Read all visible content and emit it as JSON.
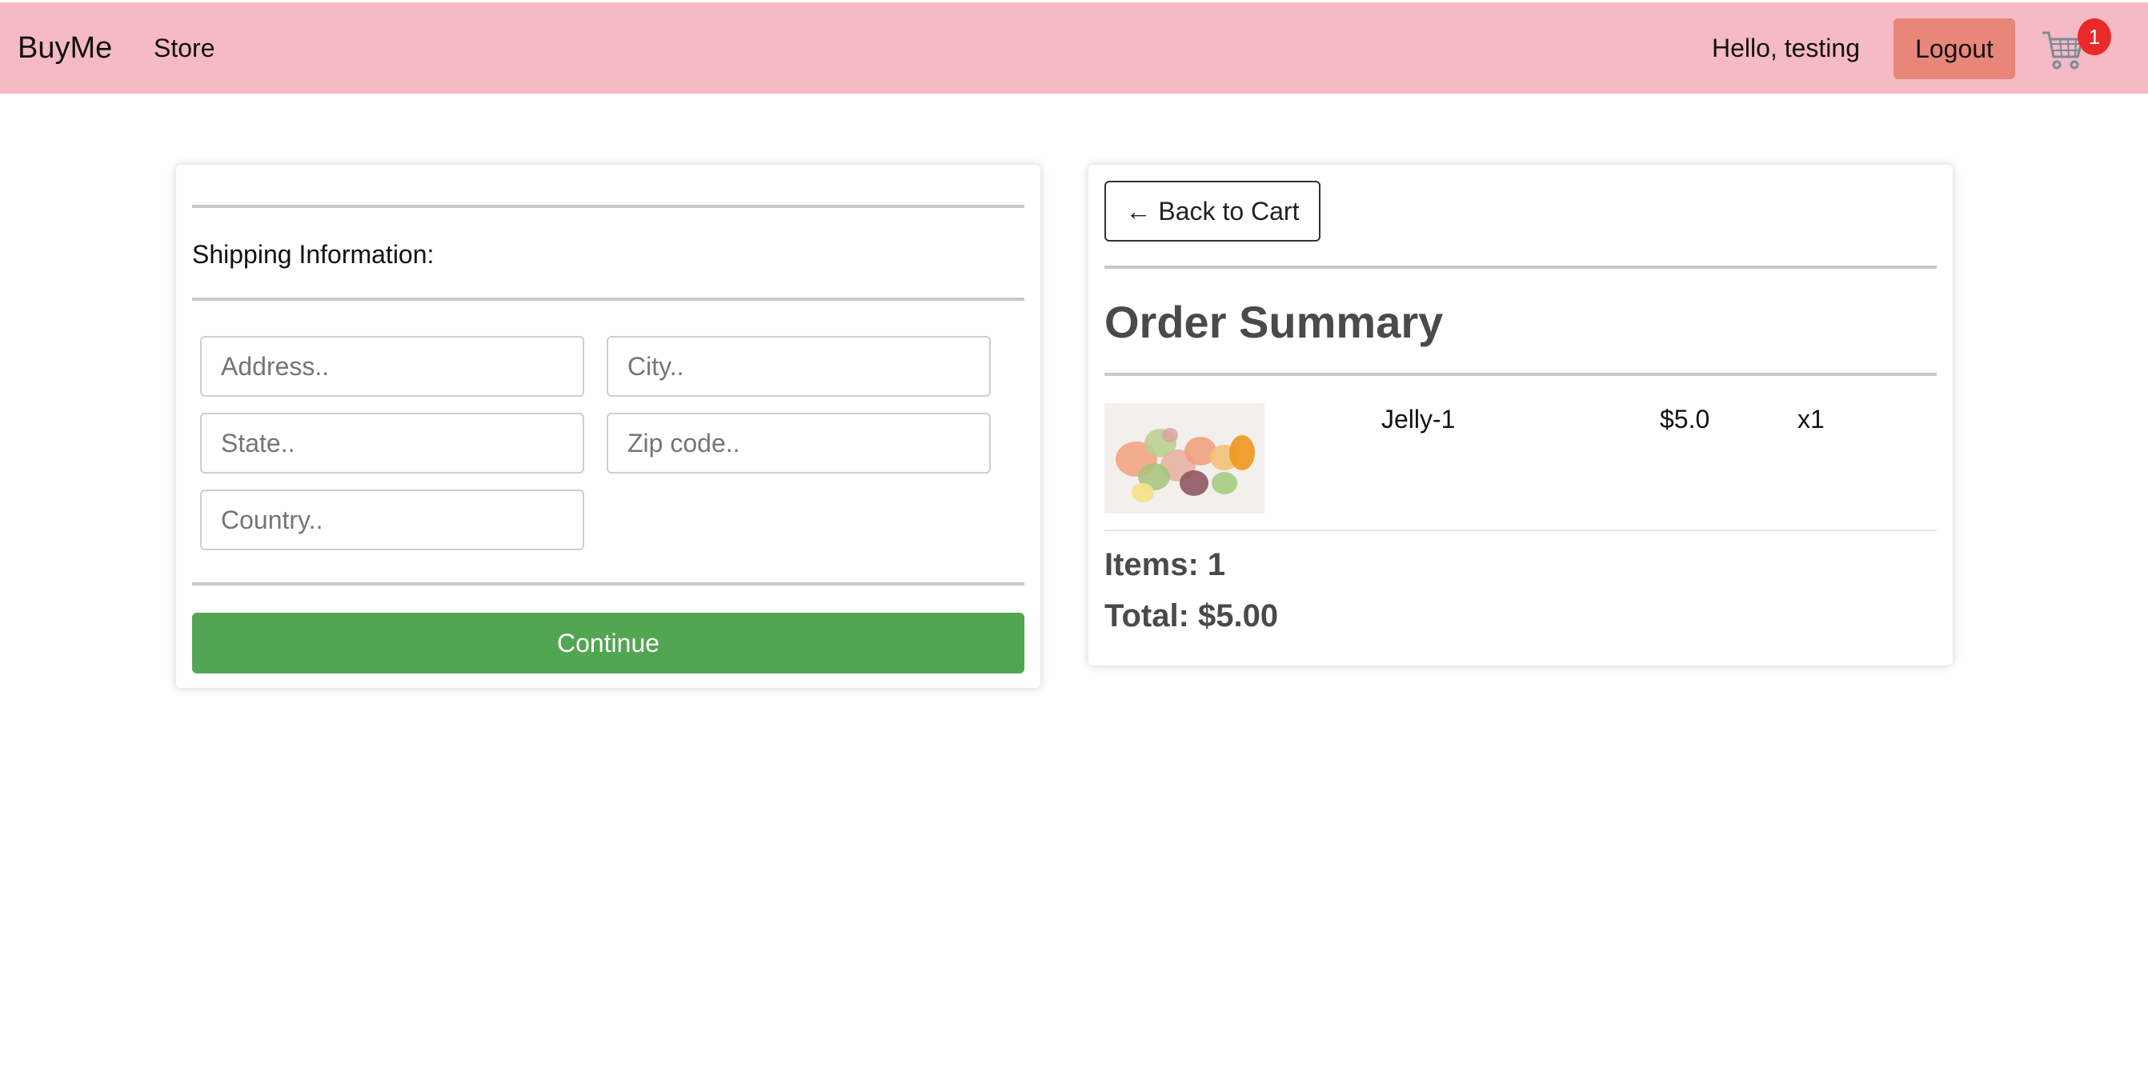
{
  "navbar": {
    "brand": "BuyMe",
    "store_link": "Store",
    "greeting": "Hello, testing",
    "logout_label": "Logout",
    "cart_icon": "shopping-cart-icon",
    "cart_count": "1",
    "colors": {
      "background": "#f5bac3",
      "logout": "#e8867a",
      "badge": "#ea2a2a"
    }
  },
  "shipping": {
    "label": "Shipping Information:",
    "fields": {
      "address_placeholder": "Address..",
      "city_placeholder": "City..",
      "state_placeholder": "State..",
      "zip_placeholder": "Zip code..",
      "country_placeholder": "Country.."
    },
    "continue_label": "Continue",
    "continue_color": "#52a653"
  },
  "summary": {
    "back_label": "← Back to Cart",
    "title": "Order Summary",
    "items": [
      {
        "image": "jelly-candy-image",
        "name": "Jelly-1",
        "price": "$5.0",
        "quantity": "x1"
      }
    ],
    "items_count": "Items: 1",
    "total": "Total: $5.00"
  }
}
